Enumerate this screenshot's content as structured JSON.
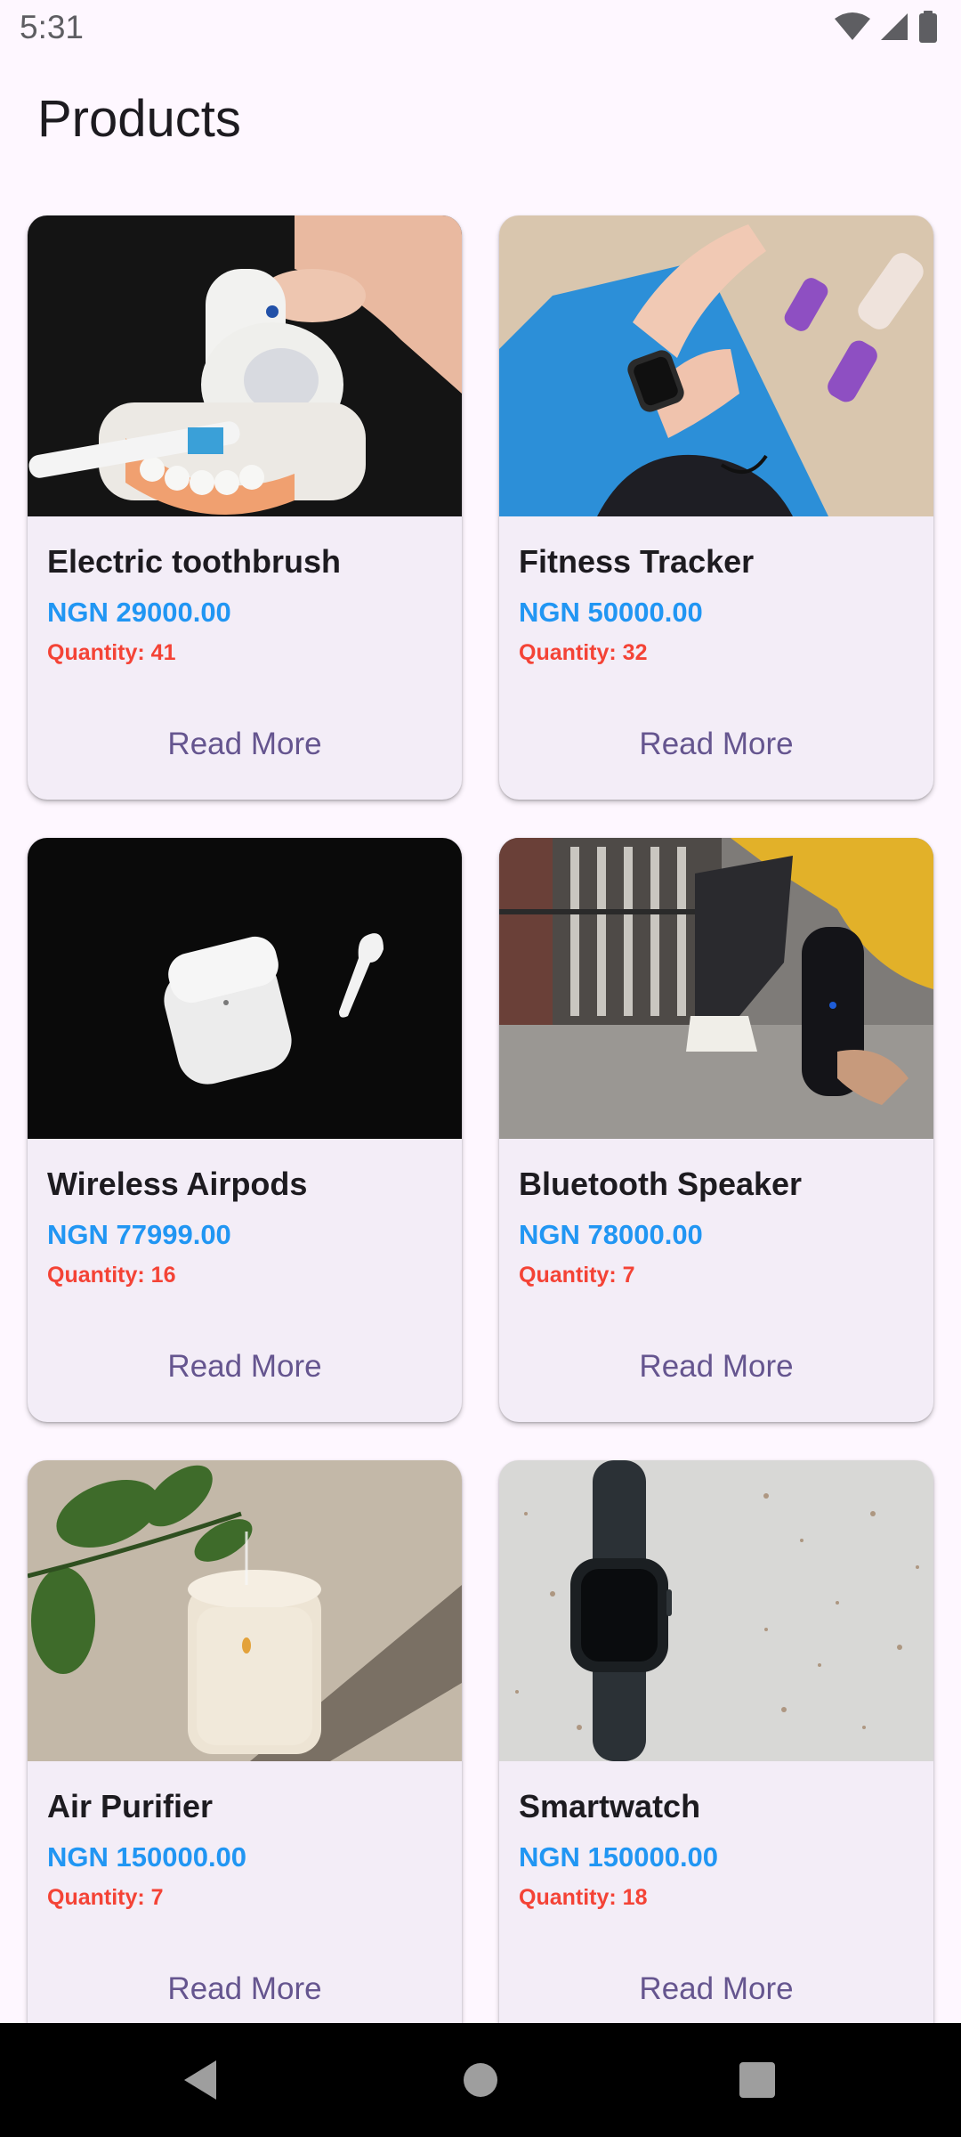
{
  "status_bar": {
    "time": "5:31",
    "icons": [
      "wifi-icon",
      "cell-signal-icon",
      "battery-icon"
    ]
  },
  "app_bar": {
    "title": "Products"
  },
  "products": [
    {
      "name": "Electric toothbrush",
      "price": "NGN 29000.00",
      "quantity": "Quantity: 41",
      "button": "Read More",
      "image": "electric-toothbrush-photo"
    },
    {
      "name": "Fitness Tracker",
      "price": "NGN 50000.00",
      "quantity": "Quantity: 32",
      "button": "Read More",
      "image": "fitness-tracker-photo"
    },
    {
      "name": "Wireless Airpods",
      "price": "NGN 77999.00",
      "quantity": "Quantity: 16",
      "button": "Read More",
      "image": "wireless-airpods-photo"
    },
    {
      "name": "Bluetooth Speaker",
      "price": "NGN 78000.00",
      "quantity": "Quantity: 7",
      "button": "Read More",
      "image": "bluetooth-speaker-photo"
    },
    {
      "name": "Air Purifier",
      "price": "NGN 150000.00",
      "quantity": "Quantity: 7",
      "button": "Read More",
      "image": "air-purifier-photo"
    },
    {
      "name": "Smartwatch",
      "price": "NGN 150000.00",
      "quantity": "Quantity: 18",
      "button": "Read More",
      "image": "smartwatch-photo"
    }
  ],
  "nav_bar": {
    "icons": [
      "back-icon",
      "home-icon",
      "recents-icon"
    ]
  },
  "colors": {
    "background": "#FEF7FF",
    "card": "#F3EDF7",
    "price": "#2196F3",
    "quantity": "#F44336",
    "button_text": "#65558F"
  }
}
